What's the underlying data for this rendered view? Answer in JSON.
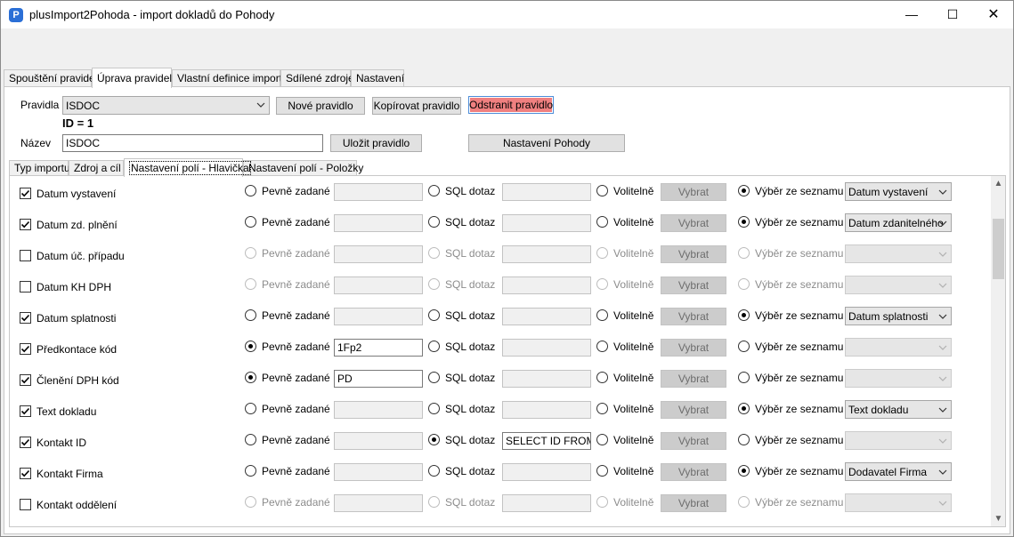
{
  "window": {
    "title": "plusImport2Pohoda - import dokladů do Pohody",
    "app_icon_letter": "P",
    "minimize": "—",
    "maximize": "☐",
    "close": "✕"
  },
  "main_tabs": [
    {
      "label": "Spouštění pravidel",
      "active": false
    },
    {
      "label": "Úprava pravidel",
      "active": true
    },
    {
      "label": "Vlastní definice importu",
      "active": false
    },
    {
      "label": "Sdílené zdroje",
      "active": false
    },
    {
      "label": "Nastavení",
      "active": false
    }
  ],
  "rule_form": {
    "pravidla_label": "Pravidla",
    "pravidla_value": "ISDOC",
    "id_text": "ID = 1",
    "nazev_label": "Název",
    "nazev_value": "ISDOC",
    "new_rule_button": "Nové pravidlo",
    "copy_rule_button": "Kopírovat pravidlo",
    "delete_rule_button": "Odstranit pravidlo",
    "save_rule_button": "Uložit pravidlo",
    "pohoda_settings_button": "Nastavení Pohody"
  },
  "sub_tabs": [
    {
      "label": "Typ importu",
      "active": false
    },
    {
      "label": "Zdroj a cíl",
      "active": false
    },
    {
      "label": "Nastavení polí - Hlavička",
      "active": true
    },
    {
      "label": "Nastavení polí - Položky",
      "active": false
    }
  ],
  "option_labels": {
    "fixed": "Pevně zadané",
    "sql": "SQL dotaz",
    "optional": "Volitelně",
    "pick_button": "Vybrat",
    "from_list": "Výběr ze seznamu"
  },
  "fields": [
    {
      "label": "Datum vystavení",
      "checked": true,
      "mode": "list",
      "fixed_value": "",
      "sql_value": "",
      "list_value": "Datum vystavení"
    },
    {
      "label": "Datum zd. plnění",
      "checked": true,
      "mode": "list",
      "fixed_value": "",
      "sql_value": "",
      "list_value": "Datum zdanitelného"
    },
    {
      "label": "Datum úč. případu",
      "checked": false,
      "mode": "",
      "fixed_value": "",
      "sql_value": "",
      "list_value": ""
    },
    {
      "label": "Datum KH DPH",
      "checked": false,
      "mode": "",
      "fixed_value": "",
      "sql_value": "",
      "list_value": ""
    },
    {
      "label": "Datum splatnosti",
      "checked": true,
      "mode": "list",
      "fixed_value": "",
      "sql_value": "",
      "list_value": "Datum splatnosti"
    },
    {
      "label": "Předkontace kód",
      "checked": true,
      "mode": "fixed",
      "fixed_value": "1Fp2",
      "sql_value": "",
      "list_value": ""
    },
    {
      "label": "Členění DPH kód",
      "checked": true,
      "mode": "fixed",
      "fixed_value": "PD",
      "sql_value": "",
      "list_value": ""
    },
    {
      "label": "Text dokladu",
      "checked": true,
      "mode": "list",
      "fixed_value": "",
      "sql_value": "",
      "list_value": "Text dokladu"
    },
    {
      "label": "Kontakt ID",
      "checked": true,
      "mode": "sql",
      "fixed_value": "",
      "sql_value": "SELECT ID FROM Ad",
      "list_value": ""
    },
    {
      "label": "Kontakt Firma",
      "checked": true,
      "mode": "list",
      "fixed_value": "",
      "sql_value": "",
      "list_value": "Dodavatel Firma"
    },
    {
      "label": "Kontakt oddělení",
      "checked": false,
      "mode": "",
      "fixed_value": "",
      "sql_value": "",
      "list_value": ""
    }
  ],
  "scrollbar": {
    "up": "▲",
    "down": "▼"
  }
}
